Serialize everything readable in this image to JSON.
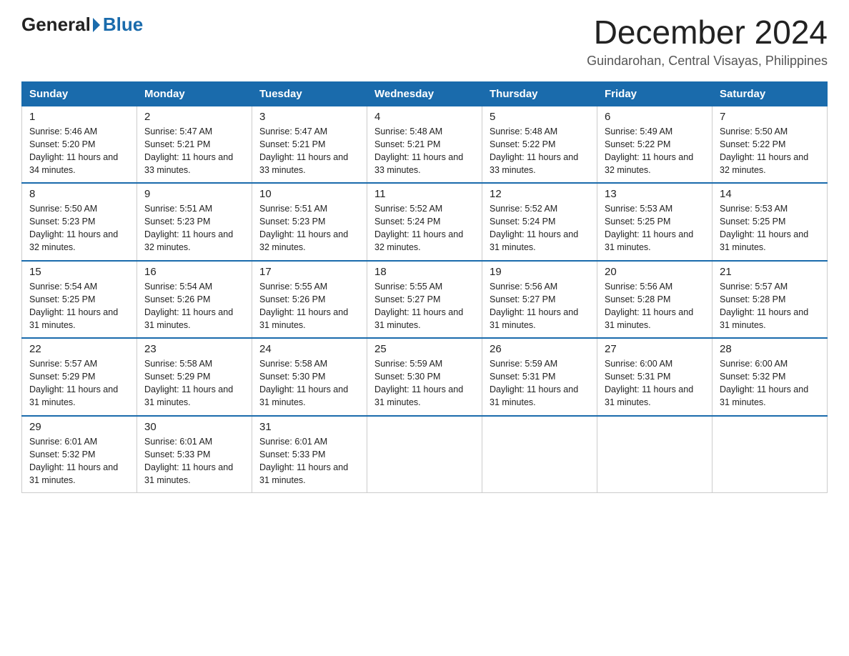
{
  "logo": {
    "general": "General",
    "blue": "Blue"
  },
  "title": "December 2024",
  "location": "Guindarohan, Central Visayas, Philippines",
  "days_of_week": [
    "Sunday",
    "Monday",
    "Tuesday",
    "Wednesday",
    "Thursday",
    "Friday",
    "Saturday"
  ],
  "weeks": [
    [
      {
        "day": "1",
        "sunrise": "5:46 AM",
        "sunset": "5:20 PM",
        "daylight": "11 hours and 34 minutes."
      },
      {
        "day": "2",
        "sunrise": "5:47 AM",
        "sunset": "5:21 PM",
        "daylight": "11 hours and 33 minutes."
      },
      {
        "day": "3",
        "sunrise": "5:47 AM",
        "sunset": "5:21 PM",
        "daylight": "11 hours and 33 minutes."
      },
      {
        "day": "4",
        "sunrise": "5:48 AM",
        "sunset": "5:21 PM",
        "daylight": "11 hours and 33 minutes."
      },
      {
        "day": "5",
        "sunrise": "5:48 AM",
        "sunset": "5:22 PM",
        "daylight": "11 hours and 33 minutes."
      },
      {
        "day": "6",
        "sunrise": "5:49 AM",
        "sunset": "5:22 PM",
        "daylight": "11 hours and 32 minutes."
      },
      {
        "day": "7",
        "sunrise": "5:50 AM",
        "sunset": "5:22 PM",
        "daylight": "11 hours and 32 minutes."
      }
    ],
    [
      {
        "day": "8",
        "sunrise": "5:50 AM",
        "sunset": "5:23 PM",
        "daylight": "11 hours and 32 minutes."
      },
      {
        "day": "9",
        "sunrise": "5:51 AM",
        "sunset": "5:23 PM",
        "daylight": "11 hours and 32 minutes."
      },
      {
        "day": "10",
        "sunrise": "5:51 AM",
        "sunset": "5:23 PM",
        "daylight": "11 hours and 32 minutes."
      },
      {
        "day": "11",
        "sunrise": "5:52 AM",
        "sunset": "5:24 PM",
        "daylight": "11 hours and 32 minutes."
      },
      {
        "day": "12",
        "sunrise": "5:52 AM",
        "sunset": "5:24 PM",
        "daylight": "11 hours and 31 minutes."
      },
      {
        "day": "13",
        "sunrise": "5:53 AM",
        "sunset": "5:25 PM",
        "daylight": "11 hours and 31 minutes."
      },
      {
        "day": "14",
        "sunrise": "5:53 AM",
        "sunset": "5:25 PM",
        "daylight": "11 hours and 31 minutes."
      }
    ],
    [
      {
        "day": "15",
        "sunrise": "5:54 AM",
        "sunset": "5:25 PM",
        "daylight": "11 hours and 31 minutes."
      },
      {
        "day": "16",
        "sunrise": "5:54 AM",
        "sunset": "5:26 PM",
        "daylight": "11 hours and 31 minutes."
      },
      {
        "day": "17",
        "sunrise": "5:55 AM",
        "sunset": "5:26 PM",
        "daylight": "11 hours and 31 minutes."
      },
      {
        "day": "18",
        "sunrise": "5:55 AM",
        "sunset": "5:27 PM",
        "daylight": "11 hours and 31 minutes."
      },
      {
        "day": "19",
        "sunrise": "5:56 AM",
        "sunset": "5:27 PM",
        "daylight": "11 hours and 31 minutes."
      },
      {
        "day": "20",
        "sunrise": "5:56 AM",
        "sunset": "5:28 PM",
        "daylight": "11 hours and 31 minutes."
      },
      {
        "day": "21",
        "sunrise": "5:57 AM",
        "sunset": "5:28 PM",
        "daylight": "11 hours and 31 minutes."
      }
    ],
    [
      {
        "day": "22",
        "sunrise": "5:57 AM",
        "sunset": "5:29 PM",
        "daylight": "11 hours and 31 minutes."
      },
      {
        "day": "23",
        "sunrise": "5:58 AM",
        "sunset": "5:29 PM",
        "daylight": "11 hours and 31 minutes."
      },
      {
        "day": "24",
        "sunrise": "5:58 AM",
        "sunset": "5:30 PM",
        "daylight": "11 hours and 31 minutes."
      },
      {
        "day": "25",
        "sunrise": "5:59 AM",
        "sunset": "5:30 PM",
        "daylight": "11 hours and 31 minutes."
      },
      {
        "day": "26",
        "sunrise": "5:59 AM",
        "sunset": "5:31 PM",
        "daylight": "11 hours and 31 minutes."
      },
      {
        "day": "27",
        "sunrise": "6:00 AM",
        "sunset": "5:31 PM",
        "daylight": "11 hours and 31 minutes."
      },
      {
        "day": "28",
        "sunrise": "6:00 AM",
        "sunset": "5:32 PM",
        "daylight": "11 hours and 31 minutes."
      }
    ],
    [
      {
        "day": "29",
        "sunrise": "6:01 AM",
        "sunset": "5:32 PM",
        "daylight": "11 hours and 31 minutes."
      },
      {
        "day": "30",
        "sunrise": "6:01 AM",
        "sunset": "5:33 PM",
        "daylight": "11 hours and 31 minutes."
      },
      {
        "day": "31",
        "sunrise": "6:01 AM",
        "sunset": "5:33 PM",
        "daylight": "11 hours and 31 minutes."
      },
      null,
      null,
      null,
      null
    ]
  ],
  "info_labels": {
    "sunrise": "Sunrise: ",
    "sunset": "Sunset: ",
    "daylight": "Daylight: "
  }
}
